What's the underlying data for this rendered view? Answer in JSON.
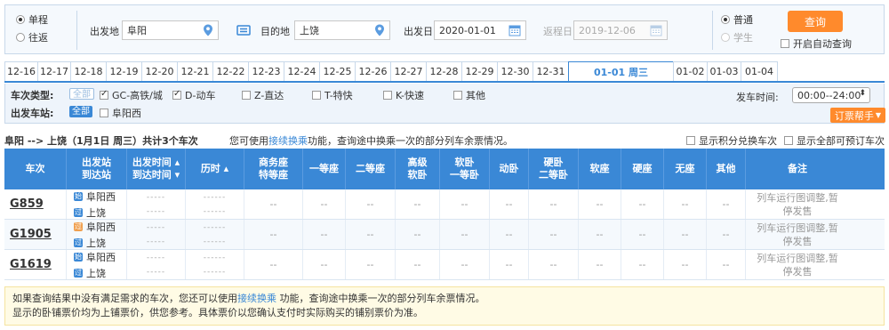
{
  "search": {
    "trip_type": {
      "one_way": "单程",
      "round_trip": "往返"
    },
    "from_label": "出发地",
    "from_value": "阜阳",
    "to_label": "目的地",
    "to_value": "上饶",
    "depart_label": "出发日",
    "depart_value": "2020-01-01",
    "return_label": "返程日",
    "return_value": "2019-12-06",
    "passenger": {
      "normal": "普通",
      "student": "学生"
    },
    "query_button": "查询",
    "auto_query_label": "开启自动查询"
  },
  "date_tabs": [
    {
      "label": "12-16",
      "active": false
    },
    {
      "label": "12-17",
      "active": false
    },
    {
      "label": "12-18",
      "active": false
    },
    {
      "label": "12-19",
      "active": false
    },
    {
      "label": "12-20",
      "active": false
    },
    {
      "label": "12-21",
      "active": false
    },
    {
      "label": "12-22",
      "active": false
    },
    {
      "label": "12-23",
      "active": false
    },
    {
      "label": "12-24",
      "active": false
    },
    {
      "label": "12-25",
      "active": false
    },
    {
      "label": "12-26",
      "active": false
    },
    {
      "label": "12-27",
      "active": false
    },
    {
      "label": "12-28",
      "active": false
    },
    {
      "label": "12-29",
      "active": false
    },
    {
      "label": "12-30",
      "active": false
    },
    {
      "label": "12-31",
      "active": false
    },
    {
      "label": "01-01 周三",
      "active": true
    },
    {
      "label": "01-02",
      "active": false
    },
    {
      "label": "01-03",
      "active": false
    },
    {
      "label": "01-04",
      "active": false
    }
  ],
  "filters": {
    "train_type_label": "车次类型:",
    "all_label": "全部",
    "train_types": [
      {
        "label": "GC-高铁/城",
        "checked": true
      },
      {
        "label": "D-动车",
        "checked": true
      },
      {
        "label": "Z-直达",
        "checked": false
      },
      {
        "label": "T-特快",
        "checked": false
      },
      {
        "label": "K-快速",
        "checked": false
      },
      {
        "label": "其他",
        "checked": false
      }
    ],
    "depart_station_label": "出发车站:",
    "depart_all_label": "全部",
    "depart_station": "阜阳西",
    "depart_time_label": "发车时间:",
    "depart_time_value": "00:00--24:00",
    "booking_help": "订票帮手"
  },
  "summary": {
    "route": "阜阳 --> 上饶（1月1日 周三）共计",
    "count": "3",
    "unit": "个车次",
    "note_prefix": "您可使用",
    "note_link": "接续换乘",
    "note_suffix": "功能，查询途中换乘一次的部分列车余票情况。",
    "show_points": "显示积分兑换车次",
    "show_all": "显示全部可预订车次"
  },
  "table": {
    "headers": [
      [
        "车次"
      ],
      [
        "出发站",
        "到达站"
      ],
      [
        "出发时间 ▴",
        "到达时间 ▾"
      ],
      [
        "历时 ▴"
      ],
      [
        "商务座",
        "特等座"
      ],
      [
        "一等座"
      ],
      [
        "二等座"
      ],
      [
        "高级",
        "软卧"
      ],
      [
        "软卧",
        "一等卧"
      ],
      [
        "动卧"
      ],
      [
        "硬卧",
        "二等卧"
      ],
      [
        "软座"
      ],
      [
        "硬座"
      ],
      [
        "无座"
      ],
      [
        "其他"
      ],
      [
        "备注"
      ]
    ],
    "rows": [
      {
        "train": "G859",
        "from": "阜阳西",
        "from_tag": "始",
        "to": "上饶",
        "to_tag": "过",
        "dep": "-----",
        "arr": "-----",
        "dur1": "------",
        "dur2": "------",
        "seats": [
          "--",
          "--",
          "--",
          "--",
          "--",
          "--",
          "--",
          "--",
          "--",
          "--",
          "--"
        ],
        "remark1": "列车运行图调整,暂",
        "remark2": "停发售"
      },
      {
        "train": "G1905",
        "from": "阜阳西",
        "from_tag": "过",
        "to": "上饶",
        "to_tag": "过",
        "dep": "-----",
        "arr": "-----",
        "dur1": "------",
        "dur2": "------",
        "seats": [
          "--",
          "--",
          "--",
          "--",
          "--",
          "--",
          "--",
          "--",
          "--",
          "--",
          "--"
        ],
        "remark1": "列车运行图调整,暂",
        "remark2": "停发售"
      },
      {
        "train": "G1619",
        "from": "阜阳西",
        "from_tag": "始",
        "to": "上饶",
        "to_tag": "过",
        "dep": "-----",
        "arr": "-----",
        "dur1": "------",
        "dur2": "------",
        "seats": [
          "--",
          "--",
          "--",
          "--",
          "--",
          "--",
          "--",
          "--",
          "--",
          "--",
          "--"
        ],
        "remark1": "列车运行图调整,暂",
        "remark2": "停发售"
      }
    ]
  },
  "notice": {
    "line1_prefix": "如果查询结果中没有满足需求的车次，您还可以使用",
    "line1_link": "接续换乘",
    "line1_suffix": " 功能，查询途中换乘一次的部分列车余票情况。",
    "line2": "显示的卧铺票价均为上铺票价，供您参考。具体票价以您确认支付时实际购买的铺别票价为准。"
  },
  "colors": {
    "accent": "#3a88d6",
    "orange": "#ff8a2c"
  }
}
